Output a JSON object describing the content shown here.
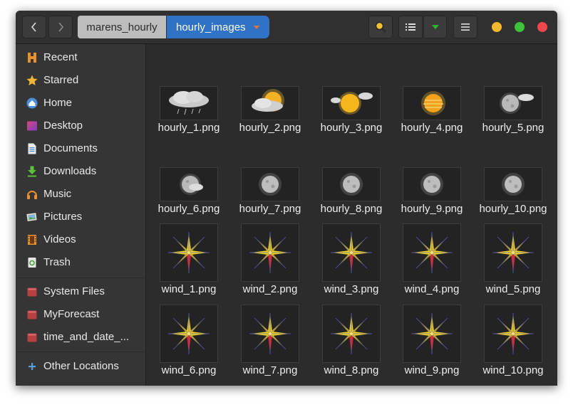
{
  "breadcrumbs": [
    "marens_hourly",
    "hourly_images"
  ],
  "window_controls": {
    "minimize_color": "#f3b82b",
    "maximize_color": "#3fc13a",
    "close_color": "#f1474c"
  },
  "sidebar": {
    "items": [
      {
        "label": "Recent",
        "icon": "recent-icon"
      },
      {
        "label": "Starred",
        "icon": "star-icon"
      },
      {
        "label": "Home",
        "icon": "home-icon"
      },
      {
        "label": "Desktop",
        "icon": "desktop-icon"
      },
      {
        "label": "Documents",
        "icon": "documents-icon"
      },
      {
        "label": "Downloads",
        "icon": "downloads-icon"
      },
      {
        "label": "Music",
        "icon": "music-icon"
      },
      {
        "label": "Pictures",
        "icon": "pictures-icon"
      },
      {
        "label": "Videos",
        "icon": "videos-icon"
      },
      {
        "label": "Trash",
        "icon": "trash-icon"
      }
    ],
    "drives": [
      {
        "label": "System Files",
        "icon": "drive-icon"
      },
      {
        "label": "MyForecast",
        "icon": "drive-icon"
      },
      {
        "label": "time_and_date_...",
        "icon": "drive-icon"
      }
    ],
    "other": {
      "label": "Other Locations",
      "icon": "plus-icon"
    }
  },
  "files": [
    {
      "name": "hourly_1.png",
      "icon": "cloud-rain-icon"
    },
    {
      "name": "hourly_2.png",
      "icon": "cloud-sun-icon"
    },
    {
      "name": "hourly_3.png",
      "icon": "sun-cloud-icon"
    },
    {
      "name": "hourly_4.png",
      "icon": "sun-haze-icon"
    },
    {
      "name": "hourly_5.png",
      "icon": "moon-cloud-icon"
    },
    {
      "name": "hourly_6.png",
      "icon": "moon-cloud-icon"
    },
    {
      "name": "hourly_7.png",
      "icon": "moon-icon"
    },
    {
      "name": "hourly_8.png",
      "icon": "moon-icon"
    },
    {
      "name": "hourly_9.png",
      "icon": "moon-icon"
    },
    {
      "name": "hourly_10.png",
      "icon": "moon-icon"
    },
    {
      "name": "wind_1.png",
      "icon": "compass-icon"
    },
    {
      "name": "wind_2.png",
      "icon": "compass-icon"
    },
    {
      "name": "wind_3.png",
      "icon": "compass-icon"
    },
    {
      "name": "wind_4.png",
      "icon": "compass-icon"
    },
    {
      "name": "wind_5.png",
      "icon": "compass-icon"
    },
    {
      "name": "wind_6.png",
      "icon": "compass-icon"
    },
    {
      "name": "wind_7.png",
      "icon": "compass-icon"
    },
    {
      "name": "wind_8.png",
      "icon": "compass-icon"
    },
    {
      "name": "wind_9.png",
      "icon": "compass-icon"
    },
    {
      "name": "wind_10.png",
      "icon": "compass-icon"
    }
  ]
}
